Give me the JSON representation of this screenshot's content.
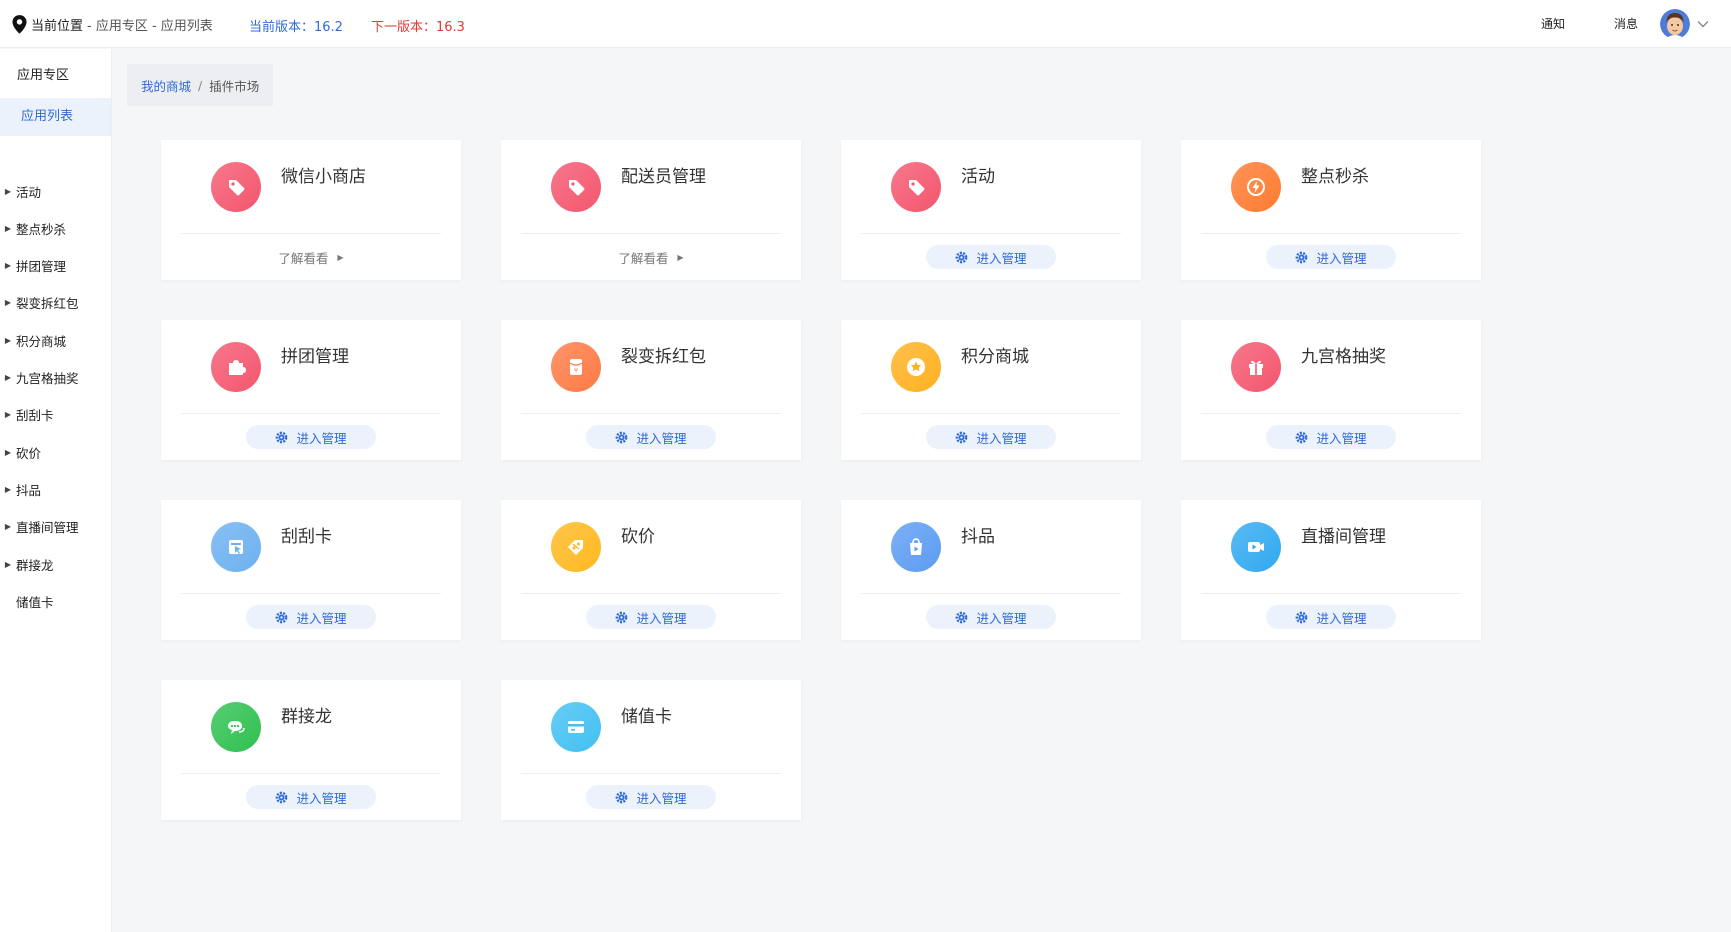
{
  "topbar": {
    "location_label": "当前位置",
    "location_path": " - 应用专区 - 应用列表",
    "current_version": "当前版本：16.2",
    "next_version": "下一版本：16.3",
    "notice": "通知",
    "messages": "消息"
  },
  "sidebar": {
    "section": "应用专区",
    "active": "应用列表",
    "items": [
      {
        "label": "活动",
        "expandable": true
      },
      {
        "label": "整点秒杀",
        "expandable": true
      },
      {
        "label": "拼团管理",
        "expandable": true
      },
      {
        "label": "裂变拆红包",
        "expandable": true
      },
      {
        "label": "积分商城",
        "expandable": true
      },
      {
        "label": "九宫格抽奖",
        "expandable": true
      },
      {
        "label": "刮刮卡",
        "expandable": true
      },
      {
        "label": "砍价",
        "expandable": true
      },
      {
        "label": "抖品",
        "expandable": true
      },
      {
        "label": "直播间管理",
        "expandable": true
      },
      {
        "label": "群接龙",
        "expandable": true
      },
      {
        "label": "储值卡",
        "expandable": false
      }
    ]
  },
  "breadcrumb": {
    "link": "我的商城",
    "separator": "/",
    "current": "插件市场"
  },
  "cards": [
    {
      "title": "微信小商店",
      "icon": "tag-icon",
      "color": "#f4566e",
      "action": "了解看看",
      "type": "learn"
    },
    {
      "title": "配送员管理",
      "icon": "tag-icon",
      "color": "#f4566e",
      "action": "了解看看",
      "type": "learn"
    },
    {
      "title": "活动",
      "icon": "tag-icon",
      "color": "#f4566e",
      "action": "进入管理",
      "type": "manage"
    },
    {
      "title": "整点秒杀",
      "icon": "lightning-icon",
      "color": "#ff7a30",
      "action": "进入管理",
      "type": "manage"
    },
    {
      "title": "拼团管理",
      "icon": "puzzle-icon",
      "color": "#f4566e",
      "action": "进入管理",
      "type": "manage"
    },
    {
      "title": "裂变拆红包",
      "icon": "red-envelope-icon",
      "color": "#ff7a45",
      "action": "进入管理",
      "type": "manage"
    },
    {
      "title": "积分商城",
      "icon": "star-coin-icon",
      "color": "#ffb020",
      "action": "进入管理",
      "type": "manage"
    },
    {
      "title": "九宫格抽奖",
      "icon": "gift-icon",
      "color": "#f4566e",
      "action": "进入管理",
      "type": "manage"
    },
    {
      "title": "刮刮卡",
      "icon": "scratch-card-icon",
      "color": "#6cb0f0",
      "action": "进入管理",
      "type": "manage"
    },
    {
      "title": "砍价",
      "icon": "discount-tag-icon",
      "color": "#ffb820",
      "action": "进入管理",
      "type": "manage"
    },
    {
      "title": "抖品",
      "icon": "play-bag-icon",
      "color": "#5b9cf2",
      "action": "进入管理",
      "type": "manage"
    },
    {
      "title": "直播间管理",
      "icon": "video-camera-icon",
      "color": "#30a9f0",
      "action": "进入管理",
      "type": "manage"
    },
    {
      "title": "群接龙",
      "icon": "chat-bubbles-icon",
      "color": "#2fc050",
      "action": "进入管理",
      "type": "manage"
    },
    {
      "title": "储值卡",
      "icon": "bank-card-icon",
      "color": "#42c0f2",
      "action": "进入管理",
      "type": "manage"
    }
  ]
}
